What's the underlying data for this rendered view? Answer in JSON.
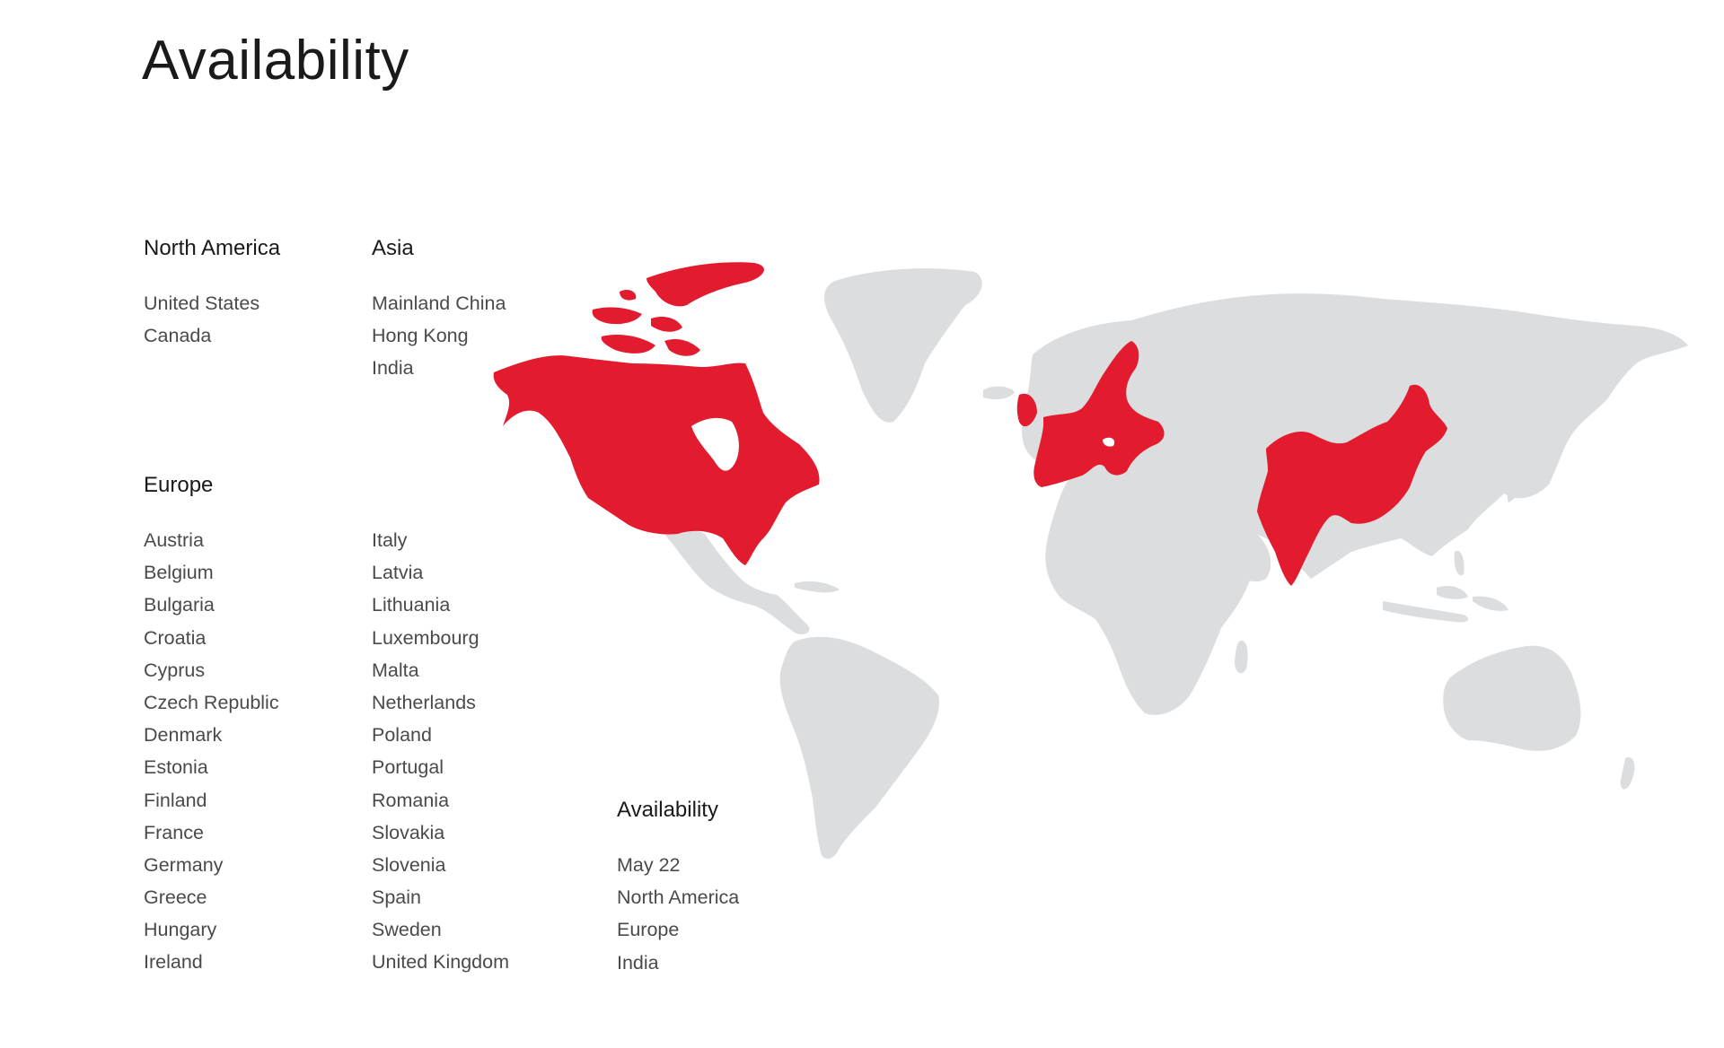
{
  "page_title": "Availability",
  "regions": {
    "north_america": {
      "heading": "North America",
      "countries": [
        "United States",
        "Canada"
      ]
    },
    "asia": {
      "heading": "Asia",
      "countries": [
        "Mainland China",
        "Hong Kong",
        "India"
      ]
    },
    "europe": {
      "heading": "Europe",
      "countries_col1": [
        "Austria",
        "Belgium",
        "Bulgaria",
        "Croatia",
        "Cyprus",
        "Czech Republic",
        "Denmark",
        "Estonia",
        "Finland",
        "France",
        "Germany",
        "Greece",
        "Hungary",
        "Ireland"
      ],
      "countries_col2": [
        "Italy",
        "Latvia",
        "Lithuania",
        "Luxembourg",
        "Malta",
        "Netherlands",
        "Poland",
        "Portugal",
        "Romania",
        "Slovakia",
        "Slovenia",
        "Spain",
        "Sweden",
        "United Kingdom"
      ]
    }
  },
  "availability": {
    "heading": "Availability",
    "items": [
      "May 22",
      "North America",
      "Europe",
      "India"
    ]
  },
  "map": {
    "highlight_color": "#e31b2e",
    "land_color": "#dcdddf",
    "highlighted_regions": [
      "North America",
      "Europe",
      "China",
      "India"
    ]
  }
}
